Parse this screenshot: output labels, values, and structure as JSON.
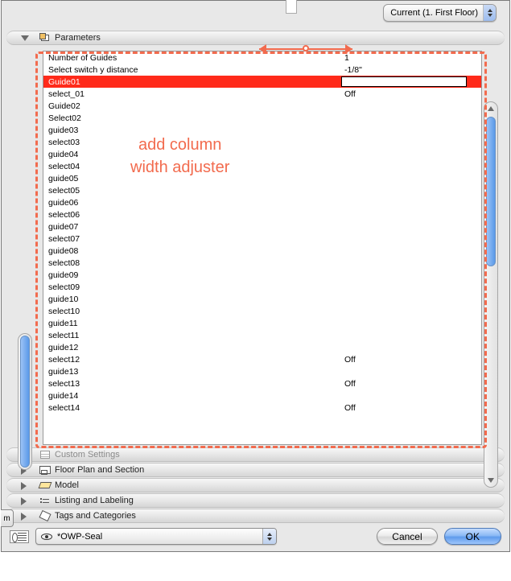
{
  "top": {
    "story_dropdown_label": "Current (1. First Floor)"
  },
  "sections": {
    "parameters": "Parameters",
    "custom": "Custom Settings",
    "floorplan": "Floor Plan and Section",
    "model": "Model",
    "listing": "Listing and Labeling",
    "tags": "Tags and Categories"
  },
  "annotation": {
    "line1": "add column",
    "line2": "width adjuster"
  },
  "parameters": [
    {
      "name": "Number of Guides",
      "value": "1",
      "selected": false
    },
    {
      "name": "Select switch y distance",
      "value": "-1/8\"",
      "selected": false
    },
    {
      "name": "Guide01",
      "value": "",
      "selected": true
    },
    {
      "name": "select_01",
      "value": "Off",
      "selected": false
    },
    {
      "name": "Guide02",
      "value": "",
      "selected": false
    },
    {
      "name": "Select02",
      "value": "",
      "selected": false
    },
    {
      "name": "guide03",
      "value": "",
      "selected": false
    },
    {
      "name": "select03",
      "value": "",
      "selected": false
    },
    {
      "name": "guide04",
      "value": "",
      "selected": false
    },
    {
      "name": "select04",
      "value": "",
      "selected": false
    },
    {
      "name": "guide05",
      "value": "",
      "selected": false
    },
    {
      "name": "select05",
      "value": "",
      "selected": false
    },
    {
      "name": "guide06",
      "value": "",
      "selected": false
    },
    {
      "name": "select06",
      "value": "",
      "selected": false
    },
    {
      "name": "guide07",
      "value": "",
      "selected": false
    },
    {
      "name": "select07",
      "value": "",
      "selected": false
    },
    {
      "name": "guide08",
      "value": "",
      "selected": false
    },
    {
      "name": "select08",
      "value": "",
      "selected": false
    },
    {
      "name": "guide09",
      "value": "",
      "selected": false
    },
    {
      "name": "select09",
      "value": "",
      "selected": false
    },
    {
      "name": "guide10",
      "value": "",
      "selected": false
    },
    {
      "name": "select10",
      "value": "",
      "selected": false
    },
    {
      "name": "guide11",
      "value": "",
      "selected": false
    },
    {
      "name": "select11",
      "value": "",
      "selected": false
    },
    {
      "name": "guide12",
      "value": "",
      "selected": false
    },
    {
      "name": "select12",
      "value": "Off",
      "selected": false
    },
    {
      "name": "guide13",
      "value": "",
      "selected": false
    },
    {
      "name": "select13",
      "value": "Off",
      "selected": false
    },
    {
      "name": "guide14",
      "value": "",
      "selected": false
    },
    {
      "name": "select14",
      "value": "Off",
      "selected": false
    }
  ],
  "bottom": {
    "layer_name": "*OWP-Seal",
    "cancel": "Cancel",
    "ok": "OK"
  },
  "left_tab": "m"
}
